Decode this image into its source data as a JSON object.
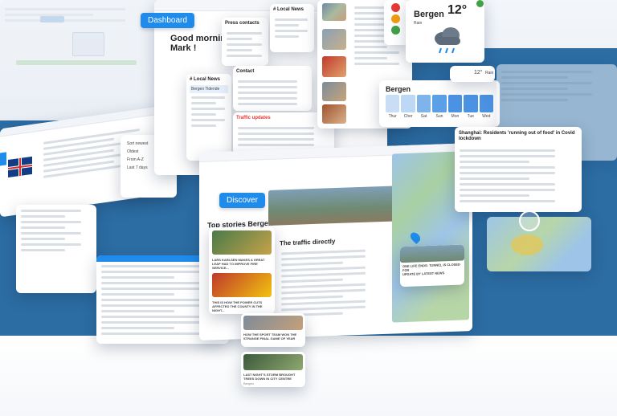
{
  "dashboard": {
    "badge": "Dashboard",
    "greeting": "Good morning,\nMark !",
    "press_contacts_title": "Press contacts",
    "local_news_title": "# Local News",
    "local_news_title2": "# Local News",
    "contact_title": "Contact",
    "traffic_title": "Traffic updates",
    "bergen_badge": "Bergen Tidende"
  },
  "weather": {
    "city": "Bergen",
    "temp": "12°",
    "condition": "Rain",
    "small_city": "Bergen",
    "small_temp": "12°",
    "small_condition": "Rain",
    "days": [
      "Thur",
      "Cher",
      "Sat",
      "Sun",
      "Mon",
      "Tue",
      "Wed"
    ],
    "bar_colors": [
      "#c9def4",
      "#bcd8f4",
      "#7fb4ea",
      "#5b9fe6",
      "#4b93e2",
      "#4b93e2",
      "#4b93e2"
    ]
  },
  "discover": {
    "badge": "Discover",
    "top_stories": "Top stories Bergen",
    "article_title": "The traffic directly",
    "map_caption": "ONE LIFE ENDS: TUNNEL IS CLOSED FOR\nUPDATE BY LATEST NEWS",
    "story_captions": [
      "LARS KARLSEN MAKES A GREAT LEAP HAD TO IMPROVE FIRE SERVICE...",
      "THIS IS HOW THE POWER CUTS AFFECTED THE COUNTY IN THE NIGHT...",
      "HOW THE SPORT TEAM WON THE STRANGE FINAL GAME OF YEAR",
      "LAST NIGHT'S STORM BROUGHT TREES DOWN IN CITY CENTRE"
    ],
    "source": "Bergen"
  },
  "shanghai": {
    "headline": "Shanghai: Residents 'running out of food' in Covid lockdown"
  },
  "sidebar": {
    "sort_options": [
      "Sort newest",
      "Oldest",
      "From A-Z",
      "Last 7 days"
    ]
  },
  "colors": {
    "accent": "#1f8ceb",
    "band": "#2c6da3",
    "red": "#e53935",
    "orange": "#f39c12",
    "green": "#43a047",
    "yellow": "#f5c518"
  }
}
